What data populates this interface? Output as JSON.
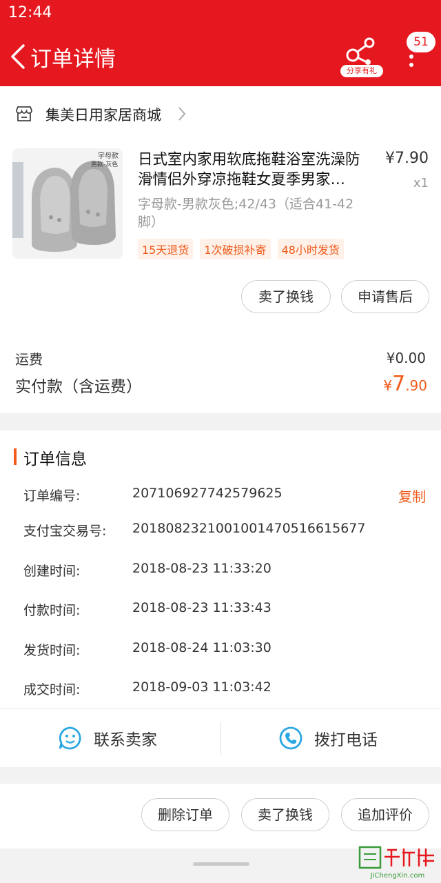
{
  "status": {
    "time": "12:44"
  },
  "header": {
    "title": "订单详情",
    "share_label": "分享有礼",
    "badge_count": "51",
    "accent": "#e6181f"
  },
  "store": {
    "name": "集美日用家居商城"
  },
  "product": {
    "title": "日式室内家用软底拖鞋浴室洗澡防滑情侣外穿凉拖鞋女夏季男家…",
    "price": "¥7.90",
    "qty": "x1",
    "spec": "字母款-男款灰色;42/43（适合41-42脚）",
    "thumb_text_1": "字母款",
    "thumb_text_2": "男款-灰色",
    "tags": [
      "15天退货",
      "1次破损补寄",
      "48小时发货"
    ]
  },
  "product_actions": {
    "sell": "卖了换钱",
    "after_sale": "申请售后"
  },
  "summary": {
    "fee_label": "运费",
    "fee_value": "¥0.00",
    "paid_label": "实付款（含运费）",
    "paid_symbol": "¥",
    "paid_int": "7",
    "paid_dec": ".90",
    "highlight": "#f05a1a"
  },
  "order_info": {
    "title": "订单信息",
    "copy": "复制",
    "rows": [
      {
        "label": "订单编号:",
        "value": "207106927742579625"
      },
      {
        "label": "支付宝交易号:",
        "value": "2018082321001001470516615677"
      },
      {
        "label": "创建时间:",
        "value": "2018-08-23 11:33:20"
      },
      {
        "label": "付款时间:",
        "value": "2018-08-23 11:33:43"
      },
      {
        "label": "发货时间:",
        "value": "2018-08-24 11:03:30"
      },
      {
        "label": "成交时间:",
        "value": "2018-09-03 11:03:42"
      }
    ]
  },
  "contact": {
    "seller": "联系卖家",
    "phone": "拨打电话"
  },
  "bottom_actions": {
    "delete": "删除订单",
    "sell": "卖了换钱",
    "review": "追加评价"
  },
  "watermark": {
    "text": "JiChengXin.com"
  }
}
